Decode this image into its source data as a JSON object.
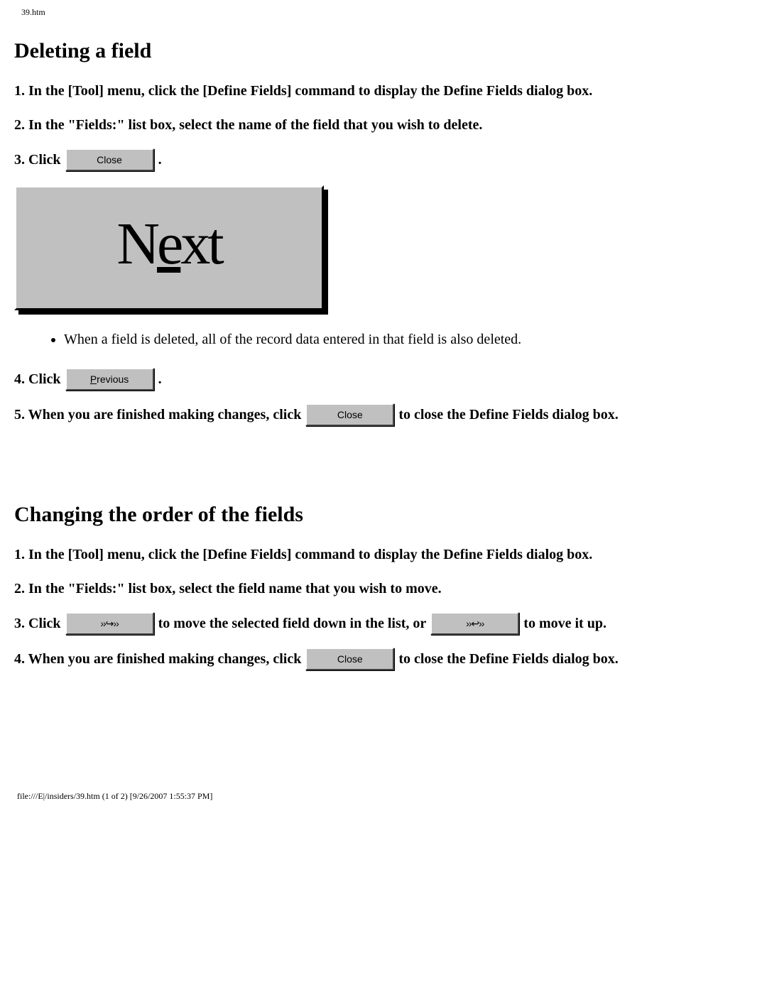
{
  "header": {
    "path": "39.htm"
  },
  "section1": {
    "title": "Deleting a field",
    "step1": "1. In the [Tool] menu, click the [Define Fields] command to display the Define Fields dialog box.",
    "step2": "2. In the \"Fields:\" list box, select the name of the field that you wish to delete.",
    "step3_prefix": "3. Click ",
    "step3_suffix": ".",
    "close_button": "Close",
    "next_button_pre": "N",
    "next_button_underline": "e",
    "next_button_post": "xt",
    "note": "When a field is deleted, all of the record data entered in that field is also deleted.",
    "step4_prefix": "4. Click ",
    "step4_suffix": ".",
    "previous_button_underline": "P",
    "previous_button_rest": "revious",
    "step5_prefix": "5. When you are finished making changes, click ",
    "step5_suffix": " to close the Define Fields dialog box.",
    "close_button2": "Close"
  },
  "section2": {
    "title": "Changing the order of the fields",
    "step1": "1. In the [Tool] menu, click the [Define Fields] command to display the Define Fields dialog box.",
    "step2": "2. In the \"Fields:\" list box, select the field name that you wish to move.",
    "step3_prefix": "3. Click ",
    "step3_middle": " to move the selected field down in the list, or ",
    "step3_suffix": " to move it up.",
    "step4_prefix": "4. When you are finished making changes, click ",
    "step4_suffix": " to close the Define Fields dialog box.",
    "close_button": "Close"
  },
  "footer": {
    "text": "file:///E|/insiders/39.htm (1 of 2) [9/26/2007 1:55:37 PM]"
  }
}
